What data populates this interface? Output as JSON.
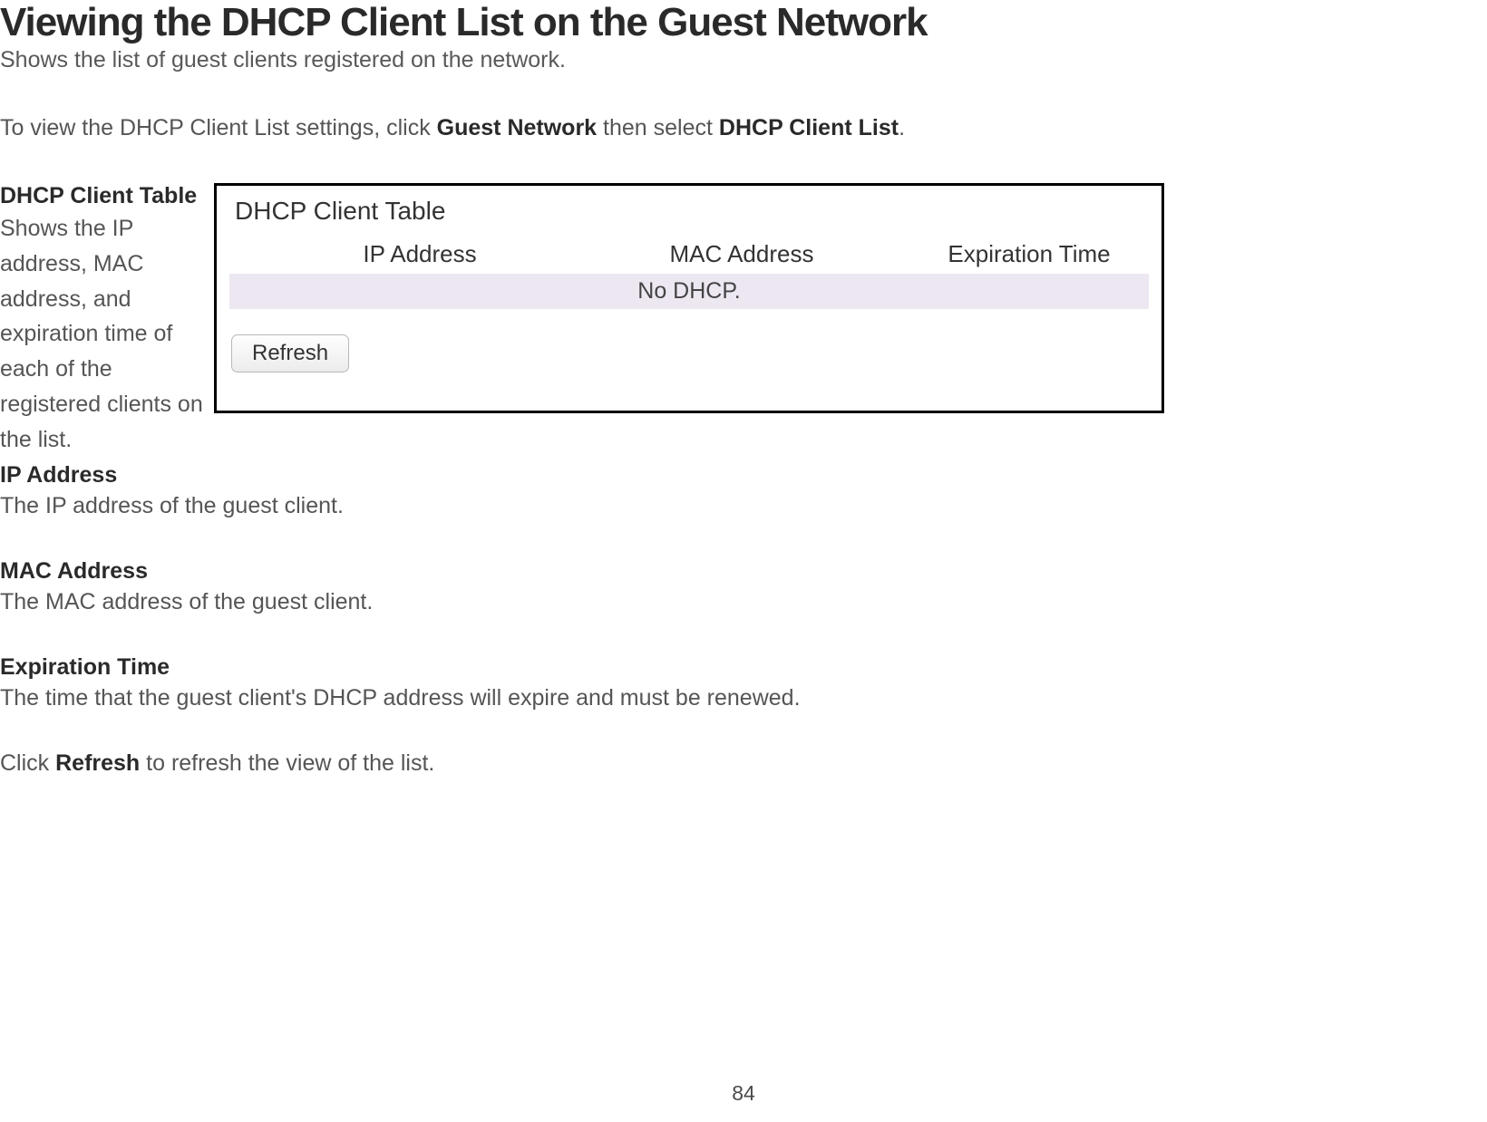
{
  "title": "Viewing the DHCP Client List on the Guest Network",
  "subtitle": "Shows the list of guest clients registered on the network.",
  "instruction": {
    "prefix": "To view the DHCP Client List settings, click ",
    "bold1": "Guest Network",
    "mid": " then select ",
    "bold2": "DHCP Client List",
    "suffix": "."
  },
  "screenshot": {
    "table_title": "DHCP Client Table",
    "columns": {
      "ip": "IP Address",
      "mac": "MAC Address",
      "exp": "Expiration Time"
    },
    "empty_row": "No DHCP.",
    "refresh_button": "Refresh"
  },
  "definitions": [
    {
      "heading": "DHCP Client Table",
      "body": "Shows the IP address, MAC address, and expiration time of each of the registered clients on the list."
    },
    {
      "heading": "IP Address",
      "body": "The IP address of the guest client."
    },
    {
      "heading": "MAC Address",
      "body": "The MAC address of the guest client."
    },
    {
      "heading": "Expiration Time",
      "body": "The time that the guest client's DHCP address will expire and must be renewed."
    }
  ],
  "final": {
    "prefix": "Click ",
    "bold": "Refresh",
    "suffix": " to refresh the view of the list."
  },
  "page_number": "84"
}
